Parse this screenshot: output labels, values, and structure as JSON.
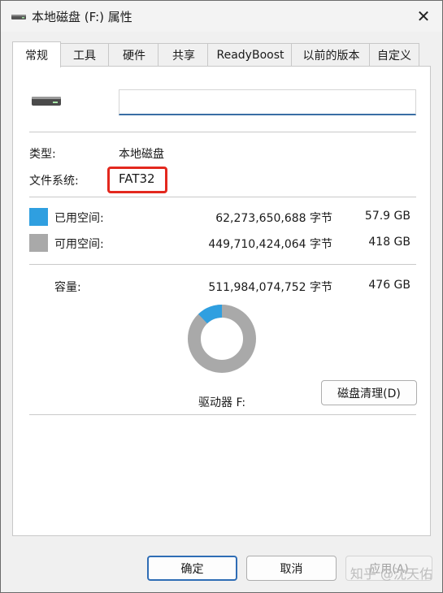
{
  "window": {
    "title": "本地磁盘 (F:) 属性",
    "close_glyph": "✕"
  },
  "tabs": [
    {
      "label": "常规",
      "active": true
    },
    {
      "label": "工具",
      "active": false
    },
    {
      "label": "硬件",
      "active": false
    },
    {
      "label": "共享",
      "active": false
    },
    {
      "label": "ReadyBoost",
      "active": false
    },
    {
      "label": "以前的版本",
      "active": false
    },
    {
      "label": "自定义",
      "active": false
    }
  ],
  "general": {
    "drive_name_value": "",
    "type_label": "类型:",
    "type_value": "本地磁盘",
    "fs_label": "文件系统:",
    "fs_value": "FAT32",
    "used_label": "已用空间:",
    "used_bytes": "62,273,650,688 字节",
    "used_size": "57.9 GB",
    "free_label": "可用空间:",
    "free_bytes": "449,710,424,064 字节",
    "free_size": "418 GB",
    "capacity_label": "容量:",
    "capacity_bytes": "511,984,074,752 字节",
    "capacity_size": "476 GB",
    "drive_label": "驱动器 F:",
    "cleanup_label": "磁盘清理(D)",
    "used_fraction": 0.1216
  },
  "colors": {
    "used": "#2f9fe0",
    "free": "#a9a9a9",
    "highlight": "#e3281e",
    "accent": "#2f6db5"
  },
  "icons": {
    "title": "drive-icon",
    "drive": "drive-icon",
    "close": "close-icon"
  },
  "footer": {
    "ok_label": "确定",
    "cancel_label": "取消",
    "apply_label": "应用(A)",
    "watermark": "知乎 @沈天佑"
  }
}
